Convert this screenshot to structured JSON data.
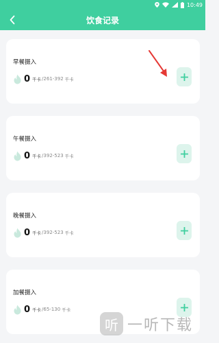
{
  "status_bar": {
    "time": "10:49",
    "icons": [
      "location-icon",
      "wifi-icon",
      "signal-icon",
      "battery-icon"
    ]
  },
  "header": {
    "title": "饮食记录",
    "back_icon": "chevron-left-icon"
  },
  "colors": {
    "accent": "#3fcf9f",
    "button_bg": "#ddf4ec",
    "flame": "#c9e9dd",
    "arrow": "#e53935"
  },
  "meals": [
    {
      "label": "早餐摄入",
      "value": "0",
      "unit": "千卡",
      "range": "/261-392",
      "range_unit": "千卡",
      "add_icon": "plus-icon"
    },
    {
      "label": "午餐摄入",
      "value": "0",
      "unit": "千卡",
      "range": "/392-523",
      "range_unit": "千卡",
      "add_icon": "plus-icon"
    },
    {
      "label": "晚餐摄入",
      "value": "0",
      "unit": "千卡",
      "range": "/392-523",
      "range_unit": "千卡",
      "add_icon": "plus-icon"
    },
    {
      "label": "加餐摄入",
      "value": "0",
      "unit": "千卡",
      "range": "/65-130",
      "range_unit": "千卡",
      "add_icon": "plus-icon"
    }
  ],
  "watermark": {
    "logo_char": "听",
    "text": "一听下载"
  }
}
